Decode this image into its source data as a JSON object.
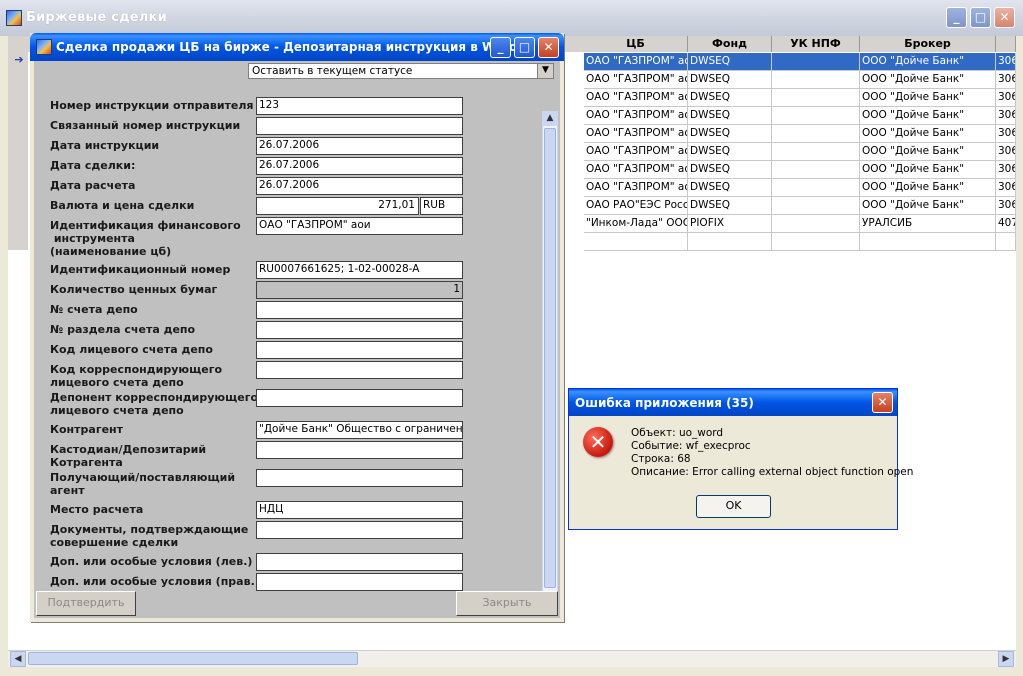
{
  "main_window": {
    "title": "Биржевые сделки",
    "minimize": "_",
    "maximize": "□",
    "close": "✕"
  },
  "grid": {
    "row_indicator": "➔",
    "columns": [
      "ЦБ",
      "Фонд",
      "УК НПФ",
      "Брокер"
    ],
    "rows": [
      {
        "cb": "ОАО \"ГАЗПРОМ\" ао",
        "fond": "DWSEQ",
        "uk": "",
        "broker": "ООО \"Дойче Банк\"",
        "extra": "306"
      },
      {
        "cb": "ОАО \"ГАЗПРОМ\" ао",
        "fond": "DWSEQ",
        "uk": "",
        "broker": "ООО \"Дойче Банк\"",
        "extra": "306"
      },
      {
        "cb": "ОАО \"ГАЗПРОМ\" ао",
        "fond": "DWSEQ",
        "uk": "",
        "broker": "ООО \"Дойче Банк\"",
        "extra": "306"
      },
      {
        "cb": "ОАО \"ГАЗПРОМ\" ао",
        "fond": "DWSEQ",
        "uk": "",
        "broker": "ООО \"Дойче Банк\"",
        "extra": "306"
      },
      {
        "cb": "ОАО \"ГАЗПРОМ\" ао",
        "fond": "DWSEQ",
        "uk": "",
        "broker": "ООО \"Дойче Банк\"",
        "extra": "306"
      },
      {
        "cb": "ОАО \"ГАЗПРОМ\" ао",
        "fond": "DWSEQ",
        "uk": "",
        "broker": "ООО \"Дойче Банк\"",
        "extra": "306"
      },
      {
        "cb": "ОАО \"ГАЗПРОМ\" ао",
        "fond": "DWSEQ",
        "uk": "",
        "broker": "ООО \"Дойче Банк\"",
        "extra": "306"
      },
      {
        "cb": "ОАО \"ГАЗПРОМ\" ао",
        "fond": "DWSEQ",
        "uk": "",
        "broker": "ООО \"Дойче Банк\"",
        "extra": "306"
      },
      {
        "cb": "ОАО РАО\"ЕЭС Росс",
        "fond": "DWSEQ",
        "uk": "",
        "broker": "ООО \"Дойче Банк\"",
        "extra": "306"
      },
      {
        "cb": "\"Инком-Лада\" ООО",
        "fond": "PIOFIX",
        "uk": "",
        "broker": "УРАЛСИБ",
        "extra": "407"
      },
      {
        "cb": "",
        "fond": "",
        "uk": "",
        "broker": "",
        "extra": ""
      }
    ]
  },
  "instruction_window": {
    "title": "Сделка продажи ЦБ на бирже - Депозитарная инструкция в Word",
    "minimize": "_",
    "maximize": "□",
    "close": "✕",
    "status_select": "Оставить в текущем статусе",
    "fields": {
      "sender_no": {
        "label": "Номер инструкции отправителя",
        "value": "123"
      },
      "linked_no": {
        "label": "Связанный номер инструкции",
        "value": ""
      },
      "instr_date": {
        "label": "Дата инструкции",
        "value": "26.07.2006"
      },
      "deal_date": {
        "label": "Дата сделки:",
        "value": "26.07.2006"
      },
      "settle_date": {
        "label": "Дата расчета",
        "value": "26.07.2006"
      },
      "currency_price": {
        "label": "Валюта и цена сделки",
        "price": "271,01",
        "currency": "RUB"
      },
      "instrument": {
        "label": "Идентификация финансового\n инструмента\n(наименование цб)",
        "value": "ОАО \"ГАЗПРОМ\" аои"
      },
      "id_number": {
        "label": "Идентификационный номер",
        "value": "RU0007661625; 1-02-00028-A"
      },
      "quantity": {
        "label": "Количество ценных бумаг",
        "value": "1"
      },
      "depo_account": {
        "label": "№ счета депо",
        "value": ""
      },
      "depo_section": {
        "label": "№ раздела счета депо",
        "value": ""
      },
      "personal_code": {
        "label": "Код лицевого счета депо",
        "value": ""
      },
      "corr_code": {
        "label": "Код корреспондирующего\nлицевого счета депо",
        "value": ""
      },
      "corr_depositor": {
        "label": "Депонент корреспондирующего\nлицевого счета депо",
        "value": ""
      },
      "counterparty": {
        "label": "Контрагент",
        "value": "\"Дойче Банк\" Общество с ограниченной"
      },
      "custodian": {
        "label": "Кастодиан/Депозитарий\nКотрагента",
        "value": ""
      },
      "agent": {
        "label": "Получающий/поставляющий\nагент",
        "value": ""
      },
      "settle_place": {
        "label": "Место расчета",
        "value": "НДЦ"
      },
      "documents": {
        "label": "Документы, подтверждающие\nсовершение сделки",
        "value": ""
      },
      "extra_left": {
        "label": "Доп. или особые условия (лев.)",
        "value": ""
      },
      "extra_right": {
        "label": "Доп. или особые условия (прав.)",
        "value": ""
      }
    },
    "confirm_button": "Подтвердить",
    "close_button": "Закрыть"
  },
  "error_dialog": {
    "title": "Ошибка приложения (35)",
    "close": "✕",
    "object": "Объект: uo_word",
    "event": "Событие: wf_execproc",
    "line": "Строка: 68",
    "description": "Описание: Error calling external object function open",
    "ok": "OK"
  },
  "colors": {
    "selection": "#316ac5",
    "xp_title_blue": "#0055e5",
    "error_red": "#c8180c"
  }
}
